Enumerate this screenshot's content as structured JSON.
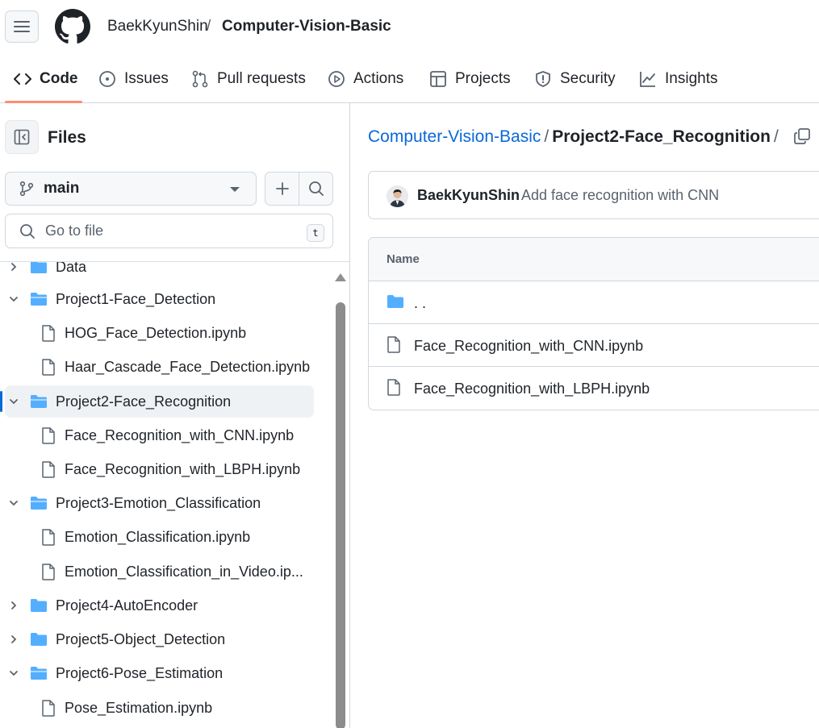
{
  "header": {
    "owner": "BaekKyunShin",
    "separator": "/",
    "repo": "Computer-Vision-Basic"
  },
  "tabs": [
    {
      "label": "Code",
      "icon": "code-icon",
      "active": true
    },
    {
      "label": "Issues",
      "icon": "issue-icon"
    },
    {
      "label": "Pull requests",
      "icon": "pull-request-icon"
    },
    {
      "label": "Actions",
      "icon": "play-icon"
    },
    {
      "label": "Projects",
      "icon": "table-icon"
    },
    {
      "label": "Security",
      "icon": "shield-icon"
    },
    {
      "label": "Insights",
      "icon": "graph-icon"
    }
  ],
  "sidebar": {
    "title": "Files",
    "branch": "main",
    "goto_placeholder": "Go to file",
    "goto_shortcut": "t",
    "tree": [
      {
        "type": "folder",
        "name": "Data",
        "expanded": false
      },
      {
        "type": "folder",
        "name": "Project1-Face_Detection",
        "expanded": true
      },
      {
        "type": "file",
        "name": "HOG_Face_Detection.ipynb"
      },
      {
        "type": "file",
        "name": "Haar_Cascade_Face_Detection.ipynb"
      },
      {
        "type": "folder",
        "name": "Project2-Face_Recognition",
        "expanded": true,
        "selected": true
      },
      {
        "type": "file",
        "name": "Face_Recognition_with_CNN.ipynb"
      },
      {
        "type": "file",
        "name": "Face_Recognition_with_LBPH.ipynb"
      },
      {
        "type": "folder",
        "name": "Project3-Emotion_Classification",
        "expanded": true
      },
      {
        "type": "file",
        "name": "Emotion_Classification.ipynb"
      },
      {
        "type": "file",
        "name": "Emotion_Classification_in_Video.ip..."
      },
      {
        "type": "folder",
        "name": "Project4-AutoEncoder",
        "expanded": false
      },
      {
        "type": "folder",
        "name": "Project5-Object_Detection",
        "expanded": false
      },
      {
        "type": "folder",
        "name": "Project6-Pose_Estimation",
        "expanded": true
      },
      {
        "type": "file",
        "name": "Pose_Estimation.ipynb"
      }
    ]
  },
  "main": {
    "path_repo": "Computer-Vision-Basic",
    "path_sep": "/",
    "path_current": "Project2-Face_Recognition",
    "path_trailing": "/",
    "commit_author": "BaekKyunShin",
    "commit_message": "Add face recognition with CNN",
    "table_header": "Name",
    "rows": [
      {
        "type": "folder",
        "name": ". ."
      },
      {
        "type": "file",
        "name": "Face_Recognition_with_CNN.ipynb"
      },
      {
        "type": "file",
        "name": "Face_Recognition_with_LBPH.ipynb"
      }
    ]
  },
  "colors": {
    "accent": "#0969da",
    "folder": "#54aeff",
    "tab_underline": "#fd8c73",
    "text": "#1f2328",
    "muted": "#59636e"
  }
}
